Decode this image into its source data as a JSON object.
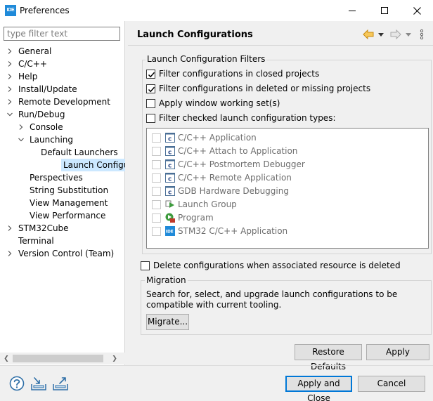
{
  "window": {
    "app_icon_text": "IDE",
    "title": "Preferences"
  },
  "filter": {
    "placeholder": "type filter text",
    "value": ""
  },
  "tree": [
    {
      "label": "General",
      "twisty": "collapsed",
      "level": 0
    },
    {
      "label": "C/C++",
      "twisty": "collapsed",
      "level": 0
    },
    {
      "label": "Help",
      "twisty": "collapsed",
      "level": 0
    },
    {
      "label": "Install/Update",
      "twisty": "collapsed",
      "level": 0
    },
    {
      "label": "Remote Development",
      "twisty": "collapsed",
      "level": 0
    },
    {
      "label": "Run/Debug",
      "twisty": "expanded",
      "level": 0
    },
    {
      "label": "Console",
      "twisty": "collapsed",
      "level": 1
    },
    {
      "label": "Launching",
      "twisty": "expanded",
      "level": 1
    },
    {
      "label": "Default Launchers",
      "twisty": "none",
      "level": 2
    },
    {
      "label": "Launch Configurations",
      "twisty": "none",
      "level": 2,
      "selected": true
    },
    {
      "label": "Perspectives",
      "twisty": "none",
      "level": 1
    },
    {
      "label": "String Substitution",
      "twisty": "none",
      "level": 1
    },
    {
      "label": "View Management",
      "twisty": "none",
      "level": 1
    },
    {
      "label": "View Performance",
      "twisty": "none",
      "level": 1
    },
    {
      "label": "STM32Cube",
      "twisty": "collapsed",
      "level": 0
    },
    {
      "label": "Terminal",
      "twisty": "none",
      "level": 0
    },
    {
      "label": "Version Control (Team)",
      "twisty": "collapsed",
      "level": 0
    }
  ],
  "page": {
    "title": "Launch Configurations"
  },
  "filters_group": {
    "legend": "Launch Configuration Filters",
    "options": [
      {
        "label": "Filter configurations in closed projects",
        "checked": true
      },
      {
        "label": "Filter configurations in deleted or missing projects",
        "checked": true
      },
      {
        "label": "Apply window working set(s)",
        "checked": false
      },
      {
        "label": "Filter checked launch configuration types:",
        "checked": false
      }
    ],
    "types": [
      {
        "label": "C/C++ Application",
        "icon": "c-launch-icon"
      },
      {
        "label": "C/C++ Attach to Application",
        "icon": "c-launch-icon"
      },
      {
        "label": "C/C++ Postmortem Debugger",
        "icon": "c-launch-icon"
      },
      {
        "label": "C/C++ Remote Application",
        "icon": "c-launch-icon"
      },
      {
        "label": "GDB Hardware Debugging",
        "icon": "c-launch-icon"
      },
      {
        "label": "Launch Group",
        "icon": "launch-group-icon"
      },
      {
        "label": "Program",
        "icon": "program-icon"
      },
      {
        "label": "STM32 C/C++ Application",
        "icon": "ide-icon",
        "icon_text": "IDE"
      }
    ]
  },
  "delete_option": {
    "label": "Delete configurations when associated resource is deleted",
    "checked": false
  },
  "migration": {
    "legend": "Migration",
    "text": "Search for, select, and upgrade launch configurations to be compatible with current tooling.",
    "button": "Migrate..."
  },
  "buttons": {
    "restore_defaults": "Restore Defaults",
    "apply": "Apply",
    "apply_and_close": "Apply and Close",
    "cancel": "Cancel"
  },
  "colors": {
    "accent": "#0078d7",
    "selection": "#cce8ff",
    "nav_arrow": "#e8a317"
  }
}
